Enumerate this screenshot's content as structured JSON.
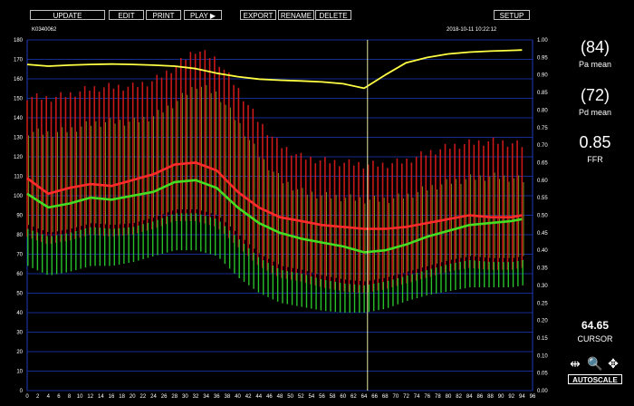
{
  "toolbar": {
    "update": "UPDATE",
    "edit": "EDIT",
    "print": "PRINT",
    "play": "PLAY ▶",
    "export": "EXPORT",
    "rename": "RENAME",
    "delete": "DELETE",
    "setup": "SETUP"
  },
  "header": {
    "record_id": "K0340062",
    "datetime": "2018-10-11 10:22:12"
  },
  "metrics": {
    "pa_value": "(84)",
    "pa_label": "Pa mean",
    "pd_value": "(72)",
    "pd_label": "Pd mean",
    "ffr_value": "0.85",
    "ffr_label": "FFR",
    "cursor_value": "64.65",
    "cursor_label": "CURSOR"
  },
  "controls": {
    "autoscale": "AUTOSCALE"
  },
  "colors": {
    "pa": "#ff2020",
    "pd": "#33cc33",
    "ffr": "#ffff44",
    "grid": "#1e3bbf",
    "cursor": "#e8e8a0"
  },
  "chart_data": {
    "type": "line",
    "x": [
      0,
      4,
      8,
      12,
      16,
      20,
      24,
      28,
      32,
      36,
      40,
      44,
      48,
      52,
      56,
      60,
      64,
      68,
      72,
      76,
      80,
      84,
      88,
      92,
      94
    ],
    "xlim": [
      0,
      96
    ],
    "x_ticks": [
      0,
      2,
      4,
      6,
      8,
      10,
      12,
      14,
      16,
      18,
      20,
      22,
      24,
      26,
      28,
      30,
      32,
      34,
      36,
      38,
      40,
      42,
      44,
      46,
      48,
      50,
      52,
      54,
      56,
      58,
      60,
      62,
      64,
      66,
      68,
      70,
      72,
      74,
      76,
      78,
      80,
      82,
      84,
      86,
      88,
      90,
      92,
      94,
      96
    ],
    "ylim_left": [
      0,
      180
    ],
    "y_ticks_left": [
      0,
      10,
      20,
      30,
      40,
      50,
      60,
      70,
      80,
      90,
      100,
      110,
      120,
      130,
      140,
      150,
      160,
      170,
      180
    ],
    "ylim_right": [
      0,
      1.0
    ],
    "y_ticks_right": [
      "0.00",
      "0.05",
      "0.10",
      "0.15",
      "0.20",
      "0.25",
      "0.30",
      "0.35",
      "0.40",
      "0.45",
      "0.50",
      "0.55",
      "0.60",
      "0.65",
      "0.70",
      "0.75",
      "0.80",
      "0.85",
      "0.90",
      "0.95",
      "1.00"
    ],
    "cursor_x": 64.65,
    "series": [
      {
        "axis": "left",
        "color": "#ff2a2a",
        "values": [
          109,
          101,
          104,
          106,
          105,
          108,
          111,
          116,
          117,
          113,
          102,
          94,
          89,
          87,
          85,
          84,
          83,
          83,
          84,
          86,
          88,
          90,
          89,
          89,
          90
        ]
      },
      {
        "axis": "left",
        "color": "#44dd22",
        "values": [
          101,
          94,
          96,
          99,
          98,
          100,
          102,
          107,
          108,
          104,
          94,
          86,
          81,
          78,
          76,
          74,
          71,
          72,
          75,
          79,
          82,
          85,
          86,
          87,
          88
        ]
      },
      {
        "axis": "right",
        "color": "#ffff44",
        "values": [
          0.93,
          0.925,
          0.928,
          0.93,
          0.931,
          0.93,
          0.928,
          0.925,
          0.918,
          0.905,
          0.895,
          0.888,
          0.885,
          0.883,
          0.88,
          0.875,
          0.862,
          0.9,
          0.935,
          0.95,
          0.96,
          0.965,
          0.968,
          0.97,
          0.971
        ]
      }
    ],
    "pressure_band": {
      "pa_sys": [
        151,
        150,
        152,
        155,
        156,
        156,
        159,
        166,
        175,
        170,
        155,
        138,
        126,
        120,
        118,
        117,
        116,
        116,
        118,
        122,
        125,
        127,
        128,
        127,
        126
      ],
      "pa_dia": [
        79,
        75,
        77,
        80,
        79,
        80,
        83,
        87,
        87,
        84,
        74,
        64,
        58,
        56,
        53,
        51,
        50,
        52,
        55,
        58,
        61,
        63,
        62,
        62,
        63
      ],
      "pd_dia": [
        68,
        63,
        65,
        68,
        68,
        70,
        73,
        76,
        76,
        73,
        62,
        54,
        49,
        47,
        45,
        44,
        44,
        46,
        50,
        53,
        55,
        57,
        57,
        57,
        58
      ],
      "beats_per_unit": 1.1
    }
  }
}
